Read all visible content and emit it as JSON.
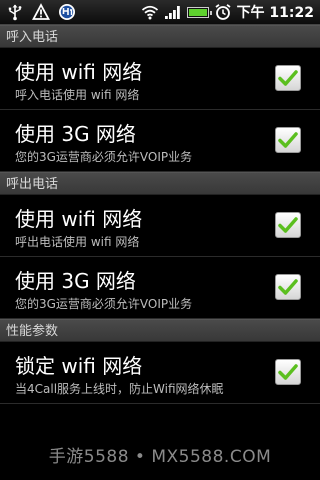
{
  "status_bar": {
    "time": "下午 11:22",
    "icons": [
      "usb-icon",
      "warning-icon",
      "app-call-icon",
      "wifi-icon",
      "signal-icon",
      "battery-icon",
      "alarm-icon"
    ]
  },
  "sections": [
    {
      "header": "呼入电话",
      "items": [
        {
          "title": "使用 wifi 网络",
          "summary": "呼入电话使用 wifi 网络",
          "checked": true
        },
        {
          "title": "使用 3G 网络",
          "summary": "您的3G运营商必须允许VOIP业务",
          "checked": true
        }
      ]
    },
    {
      "header": "呼出电话",
      "items": [
        {
          "title": "使用 wifi 网络",
          "summary": "呼出电话使用 wifi 网络",
          "checked": true
        },
        {
          "title": "使用 3G 网络",
          "summary": "您的3G运营商必须允许VOIP业务",
          "checked": true
        }
      ]
    },
    {
      "header": "性能参数",
      "items": [
        {
          "title": "锁定 wifi 网络",
          "summary": "当4Call服务上线时，防止Wifi网络休眠",
          "checked": true
        }
      ]
    }
  ],
  "watermark": "手游5588 • MX5588.COM",
  "colors": {
    "check_green": "#5bbf1f",
    "header_bg": "#3f3f3f",
    "background": "#000000"
  }
}
